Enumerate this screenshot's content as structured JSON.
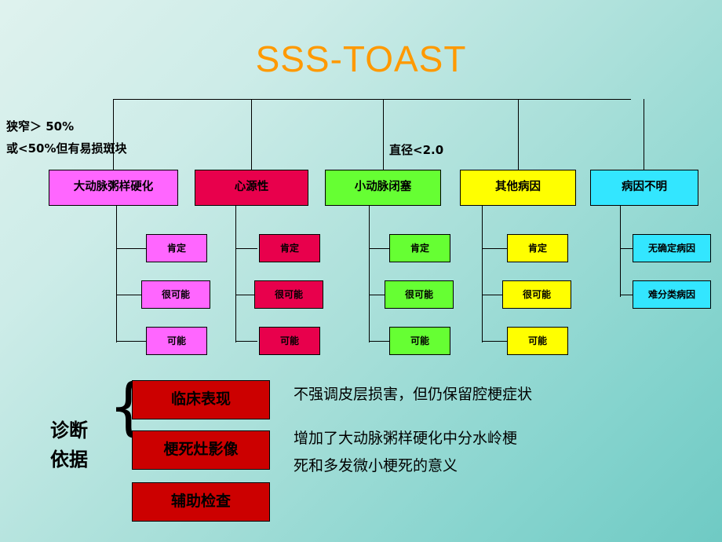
{
  "slide": {
    "title": "SSS-TOAST",
    "title_color": "#FF9900",
    "background_colors": [
      "#dff2ee",
      "#6fcac4"
    ]
  },
  "annotations": {
    "stenosis_line1": "狭窄＞ 50%",
    "stenosis_line2": "或<50%但有易损斑块",
    "diameter": "直径<2.0"
  },
  "categories": [
    {
      "id": "large-artery-atherosclerosis",
      "label": "大动脉粥样硬化",
      "color": "#FF66FF",
      "children": [
        {
          "id": "certain",
          "label": "肯定",
          "color": "#FF66FF"
        },
        {
          "id": "probable",
          "label": "很可能",
          "color": "#FF66FF"
        },
        {
          "id": "possible",
          "label": "可能",
          "color": "#FF66FF"
        }
      ]
    },
    {
      "id": "cardioembolic",
      "label": "心源性",
      "color": "#E8004C",
      "children": [
        {
          "id": "certain",
          "label": "肯定",
          "color": "#E8004C"
        },
        {
          "id": "probable",
          "label": "很可能",
          "color": "#E8004C"
        },
        {
          "id": "possible",
          "label": "可能",
          "color": "#E8004C"
        }
      ]
    },
    {
      "id": "small-artery-occlusion",
      "label": "小动脉闭塞",
      "color": "#66FF33",
      "children": [
        {
          "id": "certain",
          "label": "肯定",
          "color": "#66FF33"
        },
        {
          "id": "probable",
          "label": "很可能",
          "color": "#66FF33"
        },
        {
          "id": "possible",
          "label": "可能",
          "color": "#66FF33"
        }
      ]
    },
    {
      "id": "other-causes",
      "label": "其他病因",
      "color": "#FFFF00",
      "children": [
        {
          "id": "certain",
          "label": "肯定",
          "color": "#FFFF00"
        },
        {
          "id": "probable",
          "label": "很可能",
          "color": "#FFFF00"
        },
        {
          "id": "possible",
          "label": "可能",
          "color": "#FFFF00"
        }
      ]
    },
    {
      "id": "undetermined",
      "label": "病因不明",
      "color": "#33E6FF",
      "children": [
        {
          "id": "no-definite-cause",
          "label": "无确定病因",
          "color": "#33E6FF"
        },
        {
          "id": "hard-to-classify",
          "label": "难分类病因",
          "color": "#33E6FF"
        }
      ]
    }
  ],
  "diagnosis": {
    "label": "诊断\n依据",
    "label_line1": "诊断",
    "label_line2": "依据",
    "items": [
      {
        "id": "clinical-presentation",
        "label": "临床表现",
        "color": "#CC0000"
      },
      {
        "id": "infarct-imaging",
        "label": "梗死灶影像",
        "color": "#CC0000"
      },
      {
        "id": "auxiliary-examination",
        "label": "辅助检查",
        "color": "#CC0000"
      }
    ],
    "descriptions": [
      "不强调皮层损害，但仍保留腔梗症状",
      "增加了大动脉粥样硬化中分水岭梗",
      "死和多发微小梗死的意义"
    ]
  }
}
